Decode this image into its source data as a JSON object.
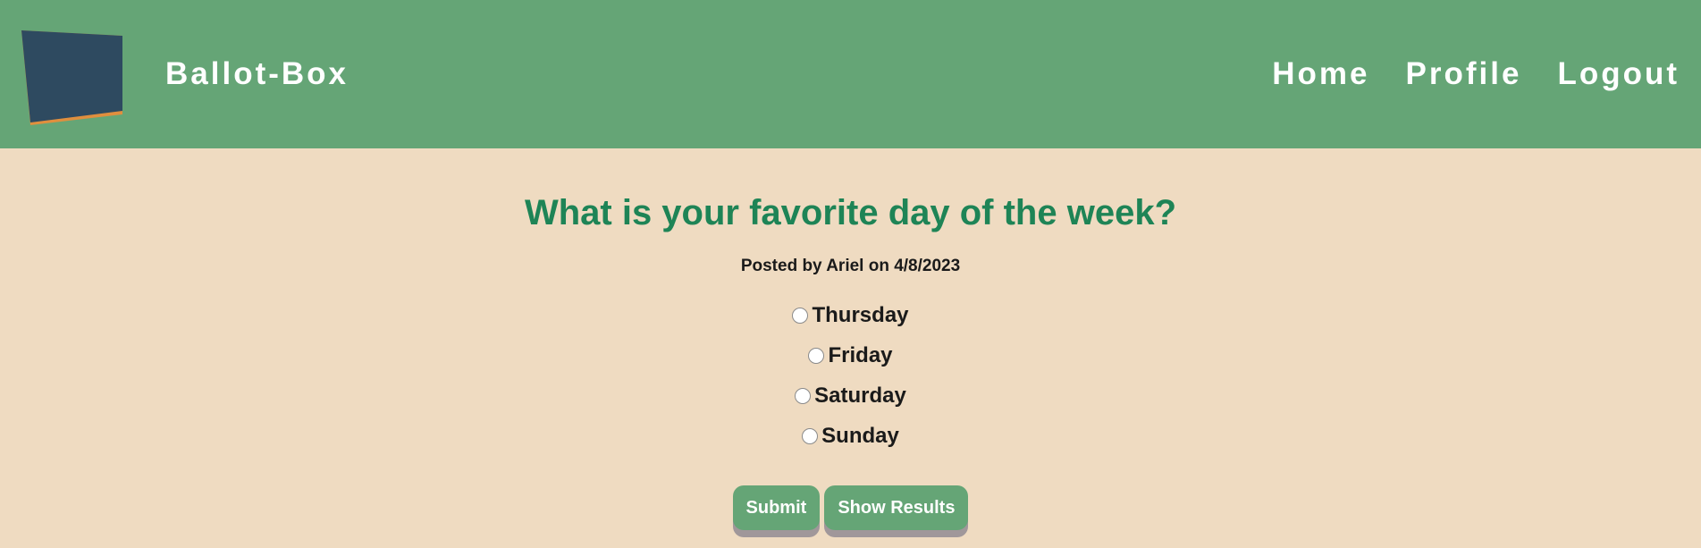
{
  "header": {
    "brand": "Ballot-Box",
    "nav": [
      "Home",
      "Profile",
      "Logout"
    ]
  },
  "poll": {
    "question": "What is your favorite day of the week?",
    "byline": "Posted by Ariel on 4/8/2023",
    "options": [
      "Thursday",
      "Friday",
      "Saturday",
      "Sunday"
    ]
  },
  "actions": {
    "submit": "Submit",
    "show_results": "Show Results"
  },
  "colors": {
    "header_bg": "#65a576",
    "page_bg": "#efdbc1",
    "question_text": "#1e8456",
    "logo_fill": "#2e4a60",
    "logo_accent": "#e08f3e"
  }
}
